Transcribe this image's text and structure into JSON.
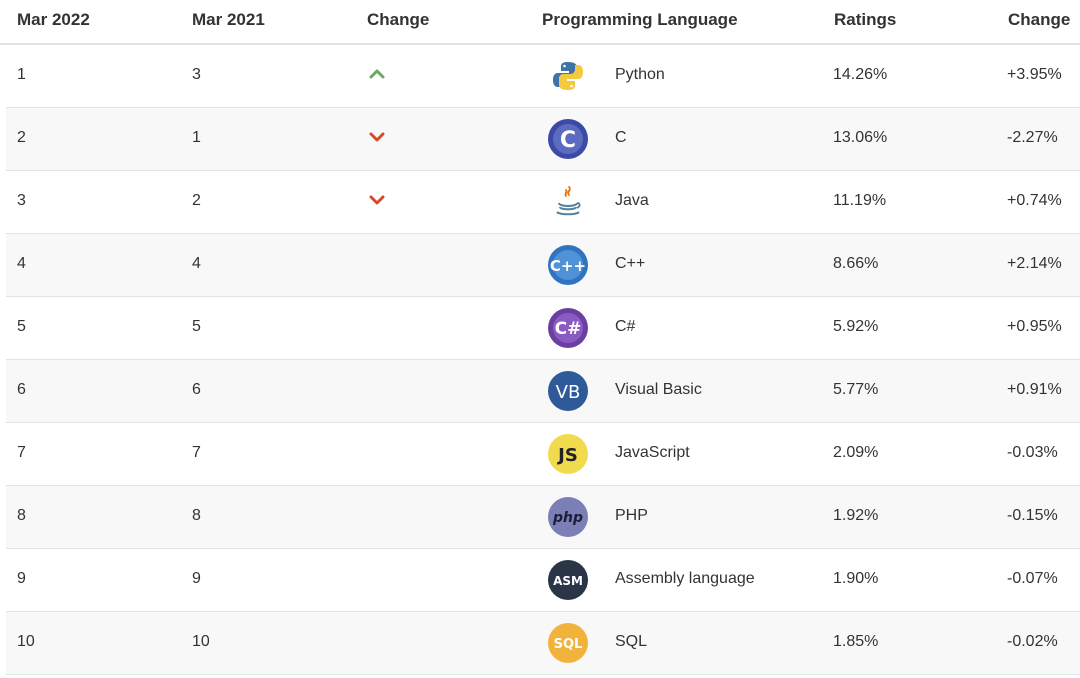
{
  "headers": [
    "Mar 2022",
    "Mar 2021",
    "Change",
    "Programming Language",
    "Ratings",
    "Change"
  ],
  "rows": [
    {
      "rank_2022": "1",
      "rank_2021": "3",
      "trend": "up",
      "language": "Python",
      "logo": "python-logo-icon",
      "rating": "14.26%",
      "change": "+3.95%"
    },
    {
      "rank_2022": "2",
      "rank_2021": "1",
      "trend": "down",
      "language": "C",
      "logo": "c-logo-icon",
      "rating": "13.06%",
      "change": "-2.27%"
    },
    {
      "rank_2022": "3",
      "rank_2021": "2",
      "trend": "down",
      "language": "Java",
      "logo": "java-logo-icon",
      "rating": "11.19%",
      "change": "+0.74%"
    },
    {
      "rank_2022": "4",
      "rank_2021": "4",
      "trend": "none",
      "language": "C++",
      "logo": "cpp-logo-icon",
      "rating": "8.66%",
      "change": "+2.14%"
    },
    {
      "rank_2022": "5",
      "rank_2021": "5",
      "trend": "none",
      "language": "C#",
      "logo": "csharp-logo-icon",
      "rating": "5.92%",
      "change": "+0.95%"
    },
    {
      "rank_2022": "6",
      "rank_2021": "6",
      "trend": "none",
      "language": "Visual Basic",
      "logo": "vb-logo-icon",
      "rating": "5.77%",
      "change": "+0.91%"
    },
    {
      "rank_2022": "7",
      "rank_2021": "7",
      "trend": "none",
      "language": "JavaScript",
      "logo": "js-logo-icon",
      "rating": "2.09%",
      "change": "-0.03%"
    },
    {
      "rank_2022": "8",
      "rank_2021": "8",
      "trend": "none",
      "language": "PHP",
      "logo": "php-logo-icon",
      "rating": "1.92%",
      "change": "-0.15%"
    },
    {
      "rank_2022": "9",
      "rank_2021": "9",
      "trend": "none",
      "language": "Assembly language",
      "logo": "asm-logo-icon",
      "rating": "1.90%",
      "change": "-0.07%"
    },
    {
      "rank_2022": "10",
      "rank_2021": "10",
      "trend": "none",
      "language": "SQL",
      "logo": "sql-logo-icon",
      "rating": "1.85%",
      "change": "-0.02%"
    }
  ],
  "logo_text": {
    "c": "C",
    "cpp": "C++",
    "csharp": "C#",
    "vb": "VB",
    "js": "JS",
    "php": "php",
    "asm": "ASM",
    "sql": "SQL"
  },
  "colors": {
    "trend_up": "#6aaa64",
    "trend_down": "#d6492b",
    "c_blue": "#3b4aa6",
    "cpp_blue": "#2f74c0",
    "csharp_purple": "#6a3fa0",
    "vb_blue": "#2e5a9a",
    "js_yellow": "#f0db4f",
    "php_purple": "#7b7fb5",
    "asm_navy": "#2b3548",
    "sql_orange": "#f2b33d"
  }
}
